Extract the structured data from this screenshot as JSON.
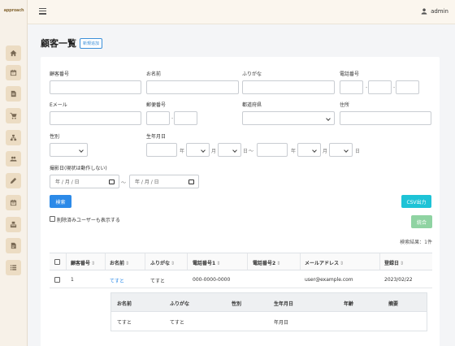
{
  "brand": "approach",
  "sidebar": {
    "items": [
      {
        "icon": "home-icon"
      },
      {
        "icon": "calendar-icon"
      },
      {
        "icon": "document-icon"
      },
      {
        "icon": "cart-icon"
      },
      {
        "icon": "network-icon"
      },
      {
        "icon": "users-icon"
      },
      {
        "icon": "pen-icon"
      },
      {
        "icon": "calendar2-icon"
      },
      {
        "icon": "machine-icon"
      },
      {
        "icon": "report-icon"
      },
      {
        "icon": "list-icon"
      }
    ]
  },
  "header": {
    "user": "admin"
  },
  "page": {
    "title": "顧客一覧",
    "new_button": "新規追加"
  },
  "search": {
    "customer_no": "顧客番号",
    "name": "お名前",
    "furigana": "ふりがな",
    "phone": "電話番号",
    "email": "Eメール",
    "zip": "郵便番号",
    "prefecture": "都道府県",
    "address": "住所",
    "gender": "性別",
    "birthdate": "生年月日",
    "year_unit": "年",
    "month_unit": "月",
    "day_unit": "日",
    "range_sep": "〜",
    "shoot_date": "撮影日(現状は動作しない)",
    "date_placeholder": "年 / 月 / 日",
    "search_button": "検索",
    "csv_button": "CSV出力",
    "include_deleted": "削除済みユーザーも表示する",
    "merge_button": "統合",
    "result_count": "検索結果：1件"
  },
  "table": {
    "columns": [
      "顧客番号",
      "お名前",
      "ふりがな",
      "電話番号1",
      "電話番号2",
      "メールアドレス",
      "登録日"
    ],
    "sort_glyph": "⇕",
    "rows": [
      {
        "id": "1",
        "name": "てすと",
        "furigana": "てすと",
        "phone1": "000-0000-0000",
        "phone2": "",
        "email": "user@example.com",
        "registered": "2023/02/22"
      }
    ],
    "detail": {
      "columns": [
        "お名前",
        "ふりがな",
        "性別",
        "生年月日",
        "年齢",
        "摘要"
      ],
      "row": [
        "てすと",
        "てすと",
        "",
        "年月日",
        "",
        ""
      ]
    }
  }
}
